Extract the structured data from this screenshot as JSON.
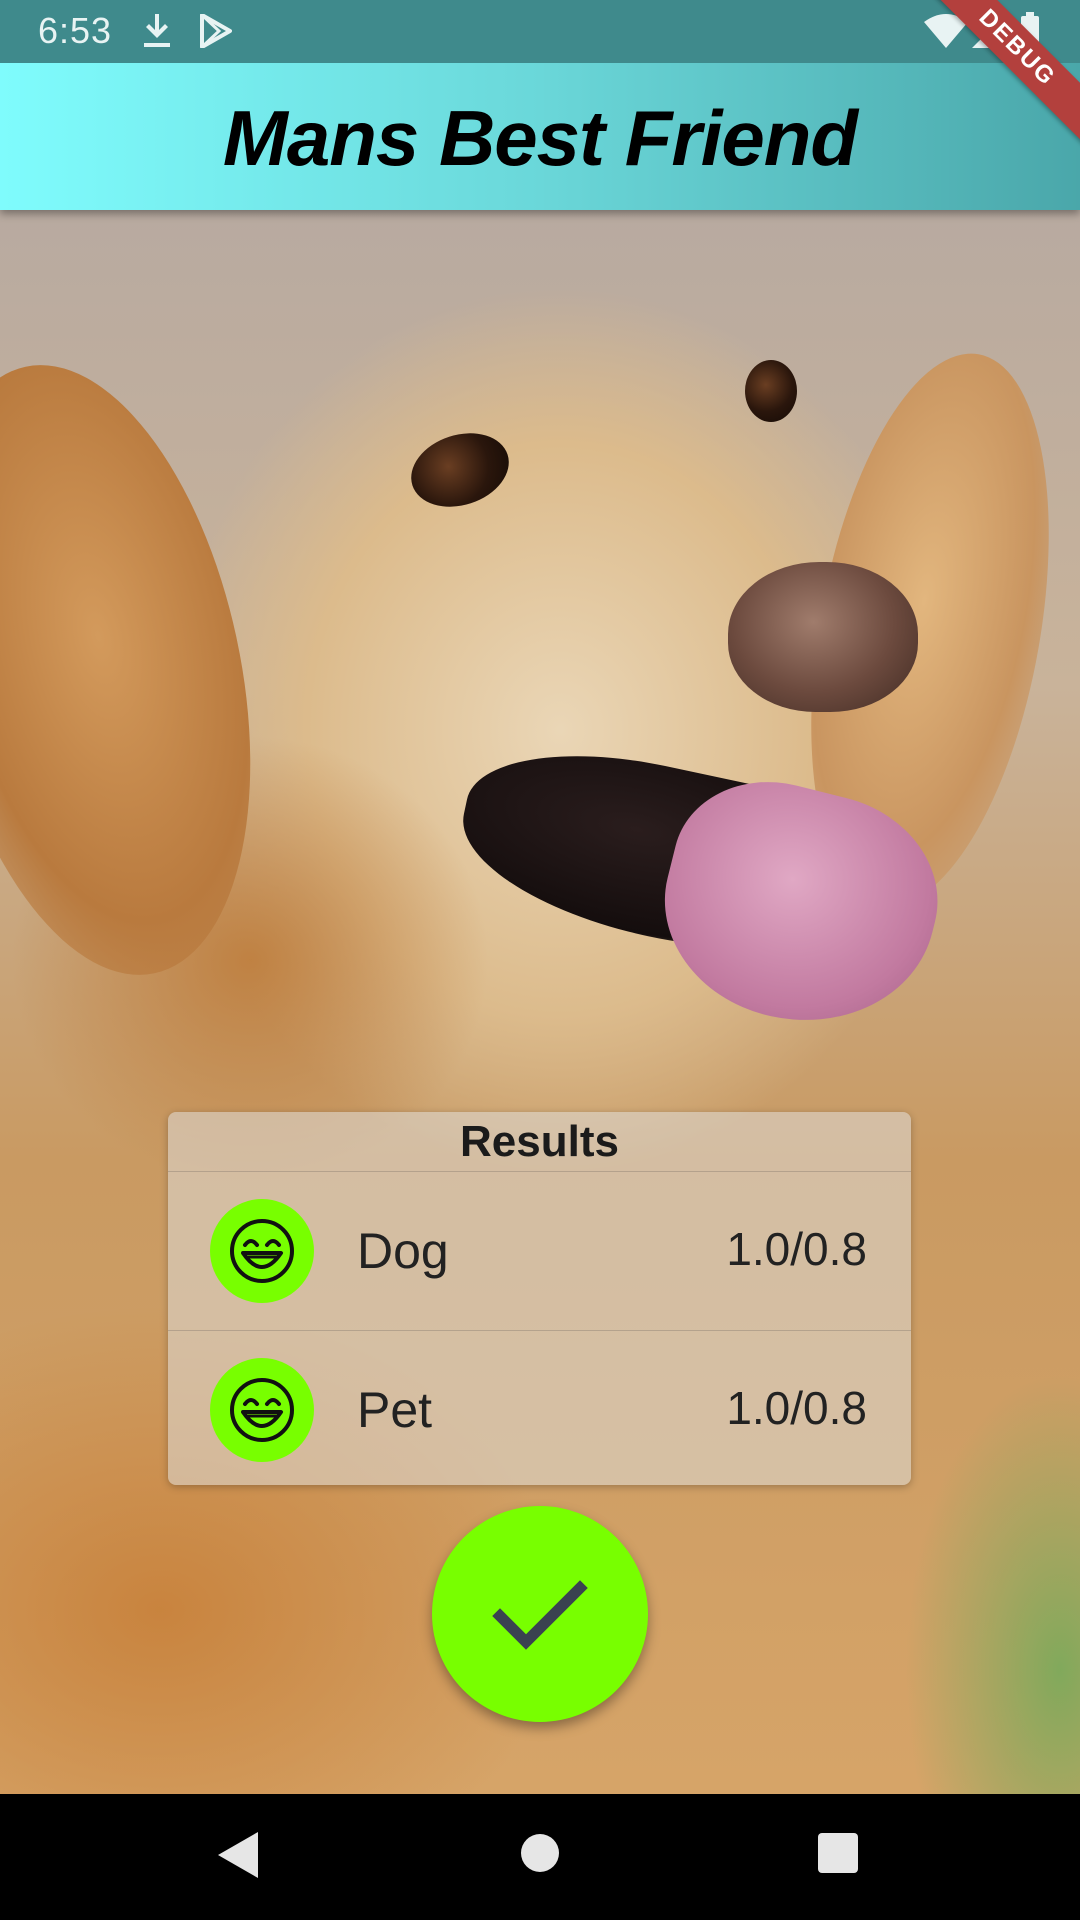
{
  "status_bar": {
    "time": "6:53",
    "left_icons": [
      "download-icon",
      "play-store-icon"
    ],
    "right_icons": [
      "wifi-icon",
      "cell-signal-icon",
      "battery-icon"
    ],
    "debug_banner": "DEBUG"
  },
  "app_bar": {
    "title": "Mans Best Friend",
    "gradient_colors": [
      "#7ffcfd",
      "#4aa7aa"
    ]
  },
  "photo": {
    "subject": "golden retriever"
  },
  "results": {
    "title": "Results",
    "items": [
      {
        "icon": "smiley-icon",
        "label": "Dog",
        "score": "1.0/0.8"
      },
      {
        "icon": "smiley-icon",
        "label": "Pet",
        "score": "1.0/0.8"
      }
    ]
  },
  "fab": {
    "icon": "check-icon",
    "color": "#78ff00"
  },
  "nav_bar": {
    "buttons": [
      "back-icon",
      "home-icon",
      "recents-icon"
    ]
  }
}
